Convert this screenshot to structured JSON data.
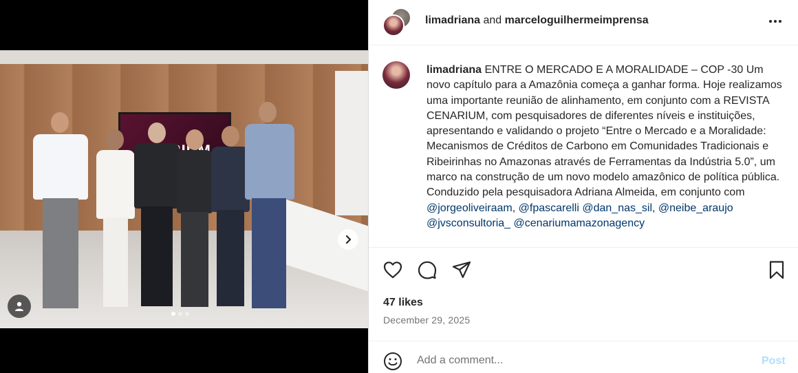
{
  "post": {
    "header": {
      "author1": "limadriana",
      "connector": "and",
      "author2": "marceloguilhermeimprensa",
      "more_icon": "more-horizontal-icon"
    },
    "caption": {
      "username": "limadriana",
      "text_before_mentions": "ENTRE O MERCADO E A MORALIDADE – COP -30 Um novo capítulo para a Amazônia começa a ganhar forma. Hoje realizamos uma importante reunião de alinhamento, em conjunto com a REVISTA CENARIUM, com pesquisadores de diferentes níveis e instituições, apresentando e validando o projeto “Entre o Mercado e a Moralidade: Mecanismos de Créditos de Carbono em Comunidades Tradicionais e Ribeirinhas no Amazonas através de Ferramentas da Indústria 5.0”, um marco na construção de um novo modelo amazônico de política pública. Conduzido pela pesquisadora Adriana Almeida, em conjunto com",
      "mentions": [
        "@jorgeoliveiraam",
        "@fpascarelli",
        "@dan_nas_sil",
        "@neibe_araujo",
        "@jvsconsultoria_",
        "@cenariumamazonagency"
      ]
    },
    "media": {
      "screen_text": "NARIUM",
      "carousel_total": 3,
      "carousel_active": 1
    },
    "actions": {
      "like_icon": "heart-icon",
      "comment_icon": "comment-icon",
      "share_icon": "share-icon",
      "save_icon": "bookmark-icon"
    },
    "likes": "47 likes",
    "date": "December 29, 2025",
    "comment": {
      "placeholder": "Add a comment...",
      "post_label": "Post"
    }
  }
}
